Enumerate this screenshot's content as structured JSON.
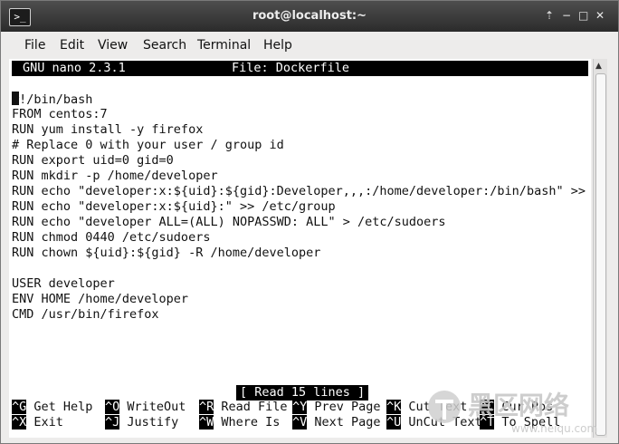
{
  "window": {
    "title": "root@localhost:~",
    "controls": [
      "⇡",
      "−",
      "□",
      "✕"
    ]
  },
  "menu": [
    "File",
    "Edit",
    "View",
    "Search",
    "Terminal",
    "Help"
  ],
  "nano": {
    "version": "GNU nano 2.3.1",
    "file": "File: Dockerfile",
    "status": "[ Read 15 lines ]"
  },
  "file_lines": [
    "#!/bin/bash",
    "FROM centos:7",
    "RUN yum install -y firefox",
    "# Replace 0 with your user / group id",
    "RUN export uid=0 gid=0",
    "RUN mkdir -p /home/developer",
    "RUN echo \"developer:x:${uid}:${gid}:Developer,,,:/home/developer:/bin/bash\" >> $",
    "RUN echo \"developer:x:${uid}:\" >> /etc/group",
    "RUN echo \"developer ALL=(ALL) NOPASSWD: ALL\" > /etc/sudoers",
    "RUN chmod 0440 /etc/sudoers",
    "RUN chown ${uid}:${gid} -R /home/developer",
    "",
    "USER developer",
    "ENV HOME /home/developer",
    "CMD /usr/bin/firefox"
  ],
  "shortcuts": [
    {
      "key": "^G",
      "label": "Get Help"
    },
    {
      "key": "^O",
      "label": "WriteOut"
    },
    {
      "key": "^R",
      "label": "Read File"
    },
    {
      "key": "^Y",
      "label": "Prev Page"
    },
    {
      "key": "^K",
      "label": "Cut Text"
    },
    {
      "key": "^C",
      "label": "Cur Pos"
    },
    {
      "key": "^X",
      "label": "Exit"
    },
    {
      "key": "^J",
      "label": "Justify"
    },
    {
      "key": "^W",
      "label": "Where Is"
    },
    {
      "key": "^V",
      "label": "Next Page"
    },
    {
      "key": "^U",
      "label": "UnCut Text"
    },
    {
      "key": "^T",
      "label": "To Spell"
    }
  ],
  "watermark": {
    "text": "黑区网络",
    "url": "www.heiqu.com"
  },
  "colors": {
    "titlebar": "#3a3a3a",
    "menubar": "#edeceb",
    "terminal_bg": "#ffffff",
    "terminal_fg": "#111111"
  }
}
